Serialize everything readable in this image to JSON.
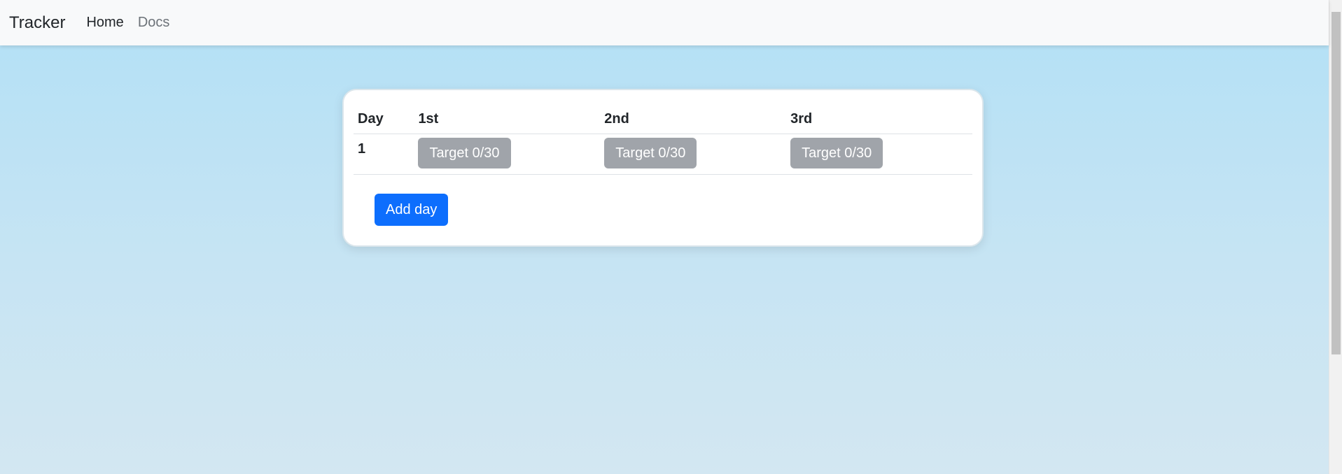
{
  "nav": {
    "brand": "Tracker",
    "links": [
      {
        "label": "Home"
      },
      {
        "label": "Docs"
      }
    ]
  },
  "table": {
    "headers": [
      "Day",
      "1st",
      "2nd",
      "3rd"
    ],
    "rows": [
      {
        "day": "1",
        "cells": [
          "Target 0/30",
          "Target 0/30",
          "Target 0/30"
        ]
      }
    ]
  },
  "actions": {
    "add_day_label": "Add day"
  },
  "colors": {
    "primary": "#0d6efd",
    "secondary": "#a0a4aa",
    "navbar_bg": "#f8f9fa",
    "page_bg_top": "#b2e0f6",
    "page_bg_bottom": "#d3e7f2"
  }
}
